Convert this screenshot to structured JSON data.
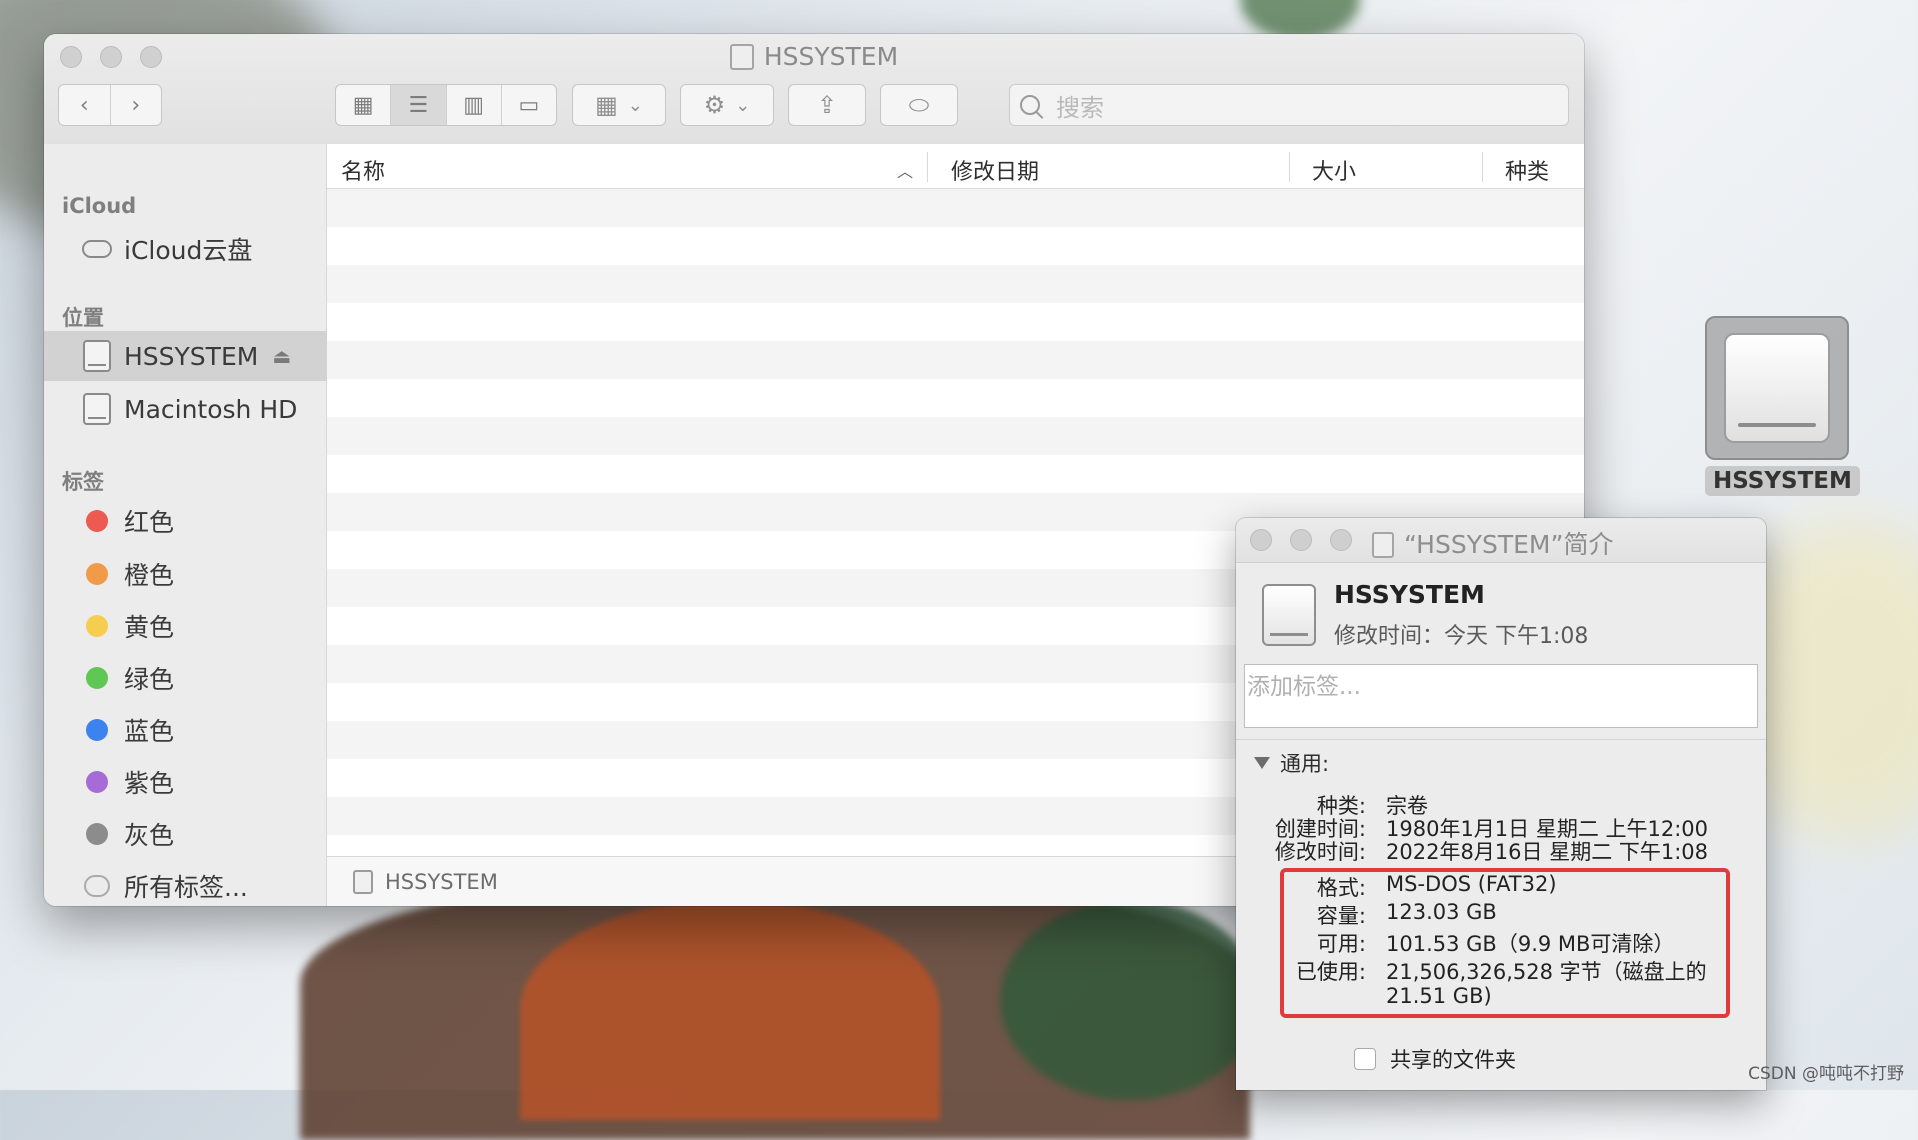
{
  "finder": {
    "title": "HSSYSTEM",
    "search_placeholder": "搜索",
    "toolbar": {
      "back_icon": "chevron-left-icon",
      "forward_icon": "chevron-right-icon",
      "view_icons": [
        "icon-view-icon",
        "list-view-icon",
        "column-view-icon",
        "gallery-view-icon"
      ],
      "group_icon": "group-icon",
      "action_icon": "gear-icon",
      "share_icon": "share-icon",
      "tag_icon": "tag-icon"
    },
    "sidebar": {
      "icloud_header": "iCloud",
      "icloud_drive": "iCloud云盘",
      "locations_header": "位置",
      "locations": [
        {
          "label": "HSSYSTEM",
          "selected": true
        },
        {
          "label": "Macintosh HD",
          "selected": false
        }
      ],
      "tags_header": "标签",
      "tags": [
        {
          "label": "红色",
          "color": "#ec5a52"
        },
        {
          "label": "橙色",
          "color": "#f19a47"
        },
        {
          "label": "黄色",
          "color": "#f5cd4f"
        },
        {
          "label": "绿色",
          "color": "#5fc754"
        },
        {
          "label": "蓝色",
          "color": "#3d83f0"
        },
        {
          "label": "紫色",
          "color": "#a66bd6"
        },
        {
          "label": "灰色",
          "color": "#8c8c8c"
        }
      ],
      "all_tags": "所有标签..."
    },
    "columns": {
      "name": "名称",
      "modified": "修改日期",
      "size": "大小",
      "kind": "种类"
    },
    "path_bar": "HSSYSTEM"
  },
  "desktop_icon": {
    "label": "HSSYSTEM"
  },
  "info_window": {
    "title": "“HSSYSTEM”简介",
    "volume_name": "HSSYSTEM",
    "modified_summary": "修改时间：今天 下午1:08",
    "tags_placeholder": "添加标签...",
    "general_header": "通用:",
    "fields": [
      {
        "key": "种类:",
        "value": "宗卷"
      },
      {
        "key": "创建时间:",
        "value": "1980年1月1日 星期二 上午12:00"
      },
      {
        "key": "修改时间:",
        "value": "2022年8月16日 星期二 下午1:08"
      },
      {
        "key": "格式:",
        "value": "MS-DOS (FAT32)"
      },
      {
        "key": "容量:",
        "value": "123.03 GB"
      },
      {
        "key": "可用:",
        "value": "101.53 GB（9.9 MB可清除）"
      },
      {
        "key": "已使用:",
        "value": "21,506,326,528 字节（磁盘上的"
      },
      {
        "key": "",
        "value": "21.51 GB)"
      }
    ],
    "shared_folder": "共享的文件夹",
    "highlight_color": "#e03a3a"
  },
  "watermark": "CSDN @吨吨不打野"
}
